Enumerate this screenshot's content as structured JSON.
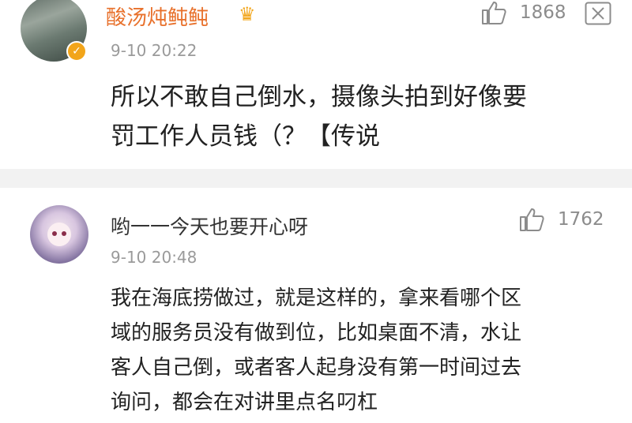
{
  "comments": [
    {
      "username": "酸汤炖鲀鲀",
      "time": "9-10 20:22",
      "likes": "1868",
      "content_lines": [
        "所以不敢自己倒水，摄像头拍到好像要",
        "罚工作人员钱（？【传说"
      ],
      "icons": {
        "avatar": "avatar-photo",
        "verified": "verified-badge-icon",
        "vip": "crown-icon",
        "like": "thumbs-up-icon",
        "more": "more-menu-icon"
      },
      "colors": {
        "username": "#e8712c",
        "verified": "#f2a51a"
      }
    },
    {
      "username": "哟一一今天也要开心呀",
      "time": "9-10 20:48",
      "likes": "1762",
      "content_lines": [
        "我在海底捞做过，就是这样的，拿来看哪个区",
        "域的服务员没有做到位，比如桌面不清，水让",
        "客人自己倒，或者客人起身没有第一时间过去",
        "询问，都会在对讲里点名叼杠"
      ],
      "icons": {
        "avatar": "avatar-anime",
        "like": "thumbs-up-icon"
      },
      "colors": {
        "username": "#333333"
      }
    }
  ]
}
